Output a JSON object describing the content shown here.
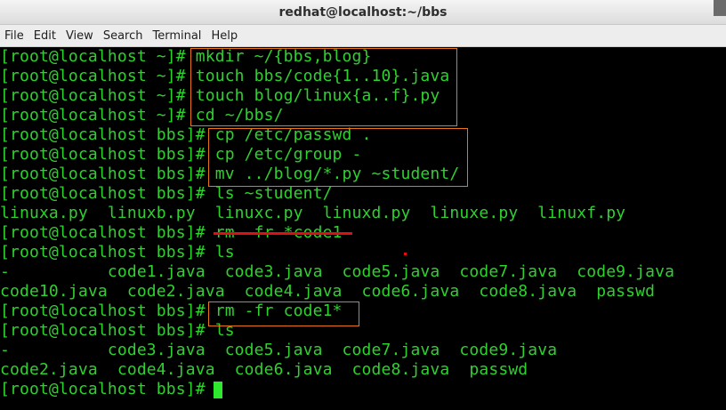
{
  "window": {
    "title": "redhat@localhost:~/bbs"
  },
  "menu": [
    "File",
    "Edit",
    "View",
    "Search",
    "Terminal",
    "Help"
  ],
  "terminal": {
    "lines": [
      "[root@localhost ~]# mkdir ~/{bbs,blog}",
      "[root@localhost ~]# touch bbs/code{1..10}.java",
      "[root@localhost ~]# touch blog/linux{a..f}.py",
      "[root@localhost ~]# cd ~/bbs/",
      "[root@localhost bbs]# cp /etc/passwd .",
      "[root@localhost bbs]# cp /etc/group -",
      "[root@localhost bbs]# mv ../blog/*.py ~student/",
      "[root@localhost bbs]# ls ~student/",
      "linuxa.py  linuxb.py  linuxc.py  linuxd.py  linuxe.py  linuxf.py",
      "[root@localhost bbs]# rm -fr *code1",
      "[root@localhost bbs]# ls",
      "-          code1.java  code3.java  code5.java  code7.java  code9.java",
      "code10.java  code2.java  code4.java  code6.java  code8.java  passwd",
      "[root@localhost bbs]# rm -fr code1*",
      "[root@localhost bbs]# ls",
      "-          code3.java  code5.java  code7.java  code9.java",
      "code2.java  code4.java  code6.java  code8.java  passwd",
      "[root@localhost bbs]# "
    ]
  },
  "colors": {
    "text": "#2ed12e",
    "background": "#000000",
    "highlight_box": "#e8741c",
    "strikethrough": "#dd1111"
  }
}
